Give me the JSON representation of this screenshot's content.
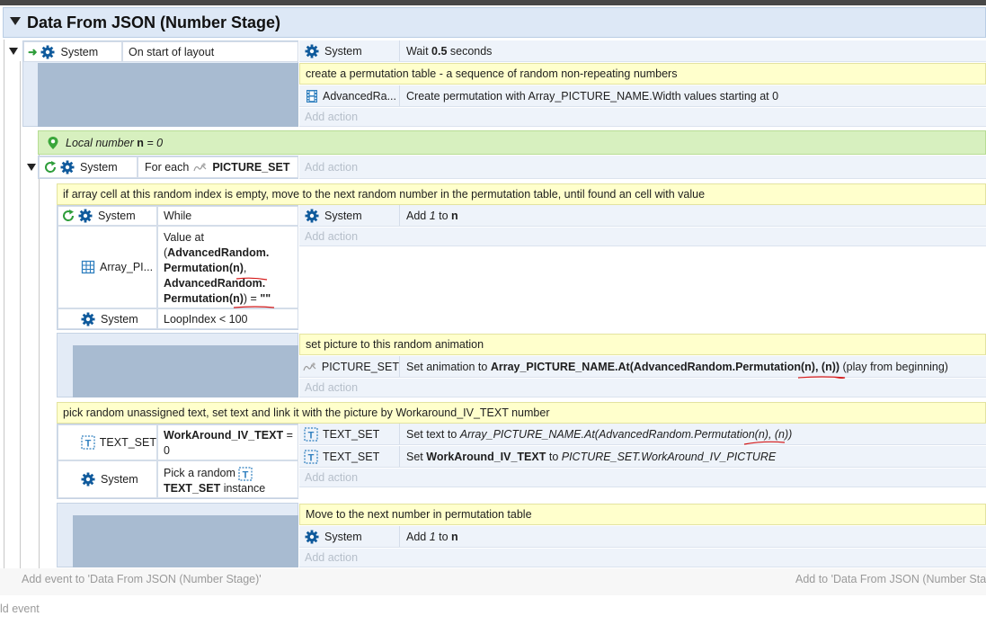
{
  "group": {
    "title": "Data From JSON (Number Stage)"
  },
  "ev1": {
    "obj": "System",
    "cond": "On start of layout",
    "act1_obj": "System",
    "act1_pre": "Wait ",
    "act1_val": "0.5",
    "act1_post": " seconds",
    "comment": "create a permutation table - a sequence of random non-repeating numbers",
    "act2_obj": "AdvancedRa...",
    "act2_text": "Create permutation with Array_PICTURE_NAME.Width values starting at 0",
    "add_action": "Add action"
  },
  "local": {
    "prefix": "Local number ",
    "name": "n",
    "suffix": " = 0"
  },
  "foreach": {
    "obj": "System",
    "cond_pre": "For each",
    "target": "PICTURE_SET",
    "add_action": "Add action"
  },
  "while_comment": "if array cell at this random index is empty, move to the next random number in the permutation table, until found an cell with value",
  "while": {
    "c1_obj": "System",
    "c1_text": "While",
    "c2_obj": "Array_PI...",
    "c2_l1": "Value at",
    "c2_l2a": "(",
    "c2_l2b": "AdvancedRandom.",
    "c2_l3a": "Permutation",
    "c2_l3b": "(n)",
    "c2_l3c": ",",
    "c2_l4": "AdvancedRandom.",
    "c2_l5a": "Permutation",
    "c2_l5b": "(n)",
    "c2_l5c": ") = ",
    "c2_l5d": "\"\"",
    "c3_obj": "System",
    "c3_text": "LoopIndex < 100",
    "act_obj": "System",
    "act_pre": "Add ",
    "act_num": "1",
    "act_mid": " to ",
    "act_var": "n",
    "add_action": "Add action"
  },
  "anim": {
    "comment": "set picture to this random animation",
    "obj": "PICTURE_SET",
    "pre": "Set animation to ",
    "expr": "Array_PICTURE_NAME.At(AdvancedRandom.Permutation(n), (n))",
    "post": " (play from beginning)",
    "add_action": "Add action"
  },
  "text": {
    "comment": "pick random unassigned text, set text and link it with the picture by Workaround_IV_TEXT number",
    "c1_obj": "TEXT_SET",
    "c1_var": "WorkAround_IV_TEXT",
    "c1_op": " =",
    "c1_val": "0",
    "c2_obj": "System",
    "c2_pre": "Pick a random",
    "c2_target": "TEXT_SET",
    "c2_post": " instance",
    "a1_obj": "TEXT_SET",
    "a1_pre": "Set text to ",
    "a1_expr": "Array_PICTURE_NAME.At(AdvancedRandom.Permutation",
    "a1_tail": "(n), (n))",
    "a2_obj": "TEXT_SET",
    "a2_pre": "Set ",
    "a2_var": "WorkAround_IV_TEXT",
    "a2_mid": " to ",
    "a2_expr": "PICTURE_SET.WorkAround_IV_PICTURE",
    "add_action": "Add action"
  },
  "next": {
    "comment": "Move to the next number in permutation table",
    "obj": "System",
    "pre": "Add ",
    "num": "1",
    "mid": " to ",
    "var": "n",
    "add_action": "Add action"
  },
  "footer": {
    "add_event": "Add event to 'Data From JSON (Number Stage)'",
    "add_to": "Add to 'Data From JSON (Number Sta",
    "add_event2": "ld event"
  },
  "colors": {
    "system_gear": "#0f5a9c",
    "green_loop": "#2e9d3a",
    "local_bg": "#d7f0bf",
    "comment_bg": "#ffffcc"
  }
}
